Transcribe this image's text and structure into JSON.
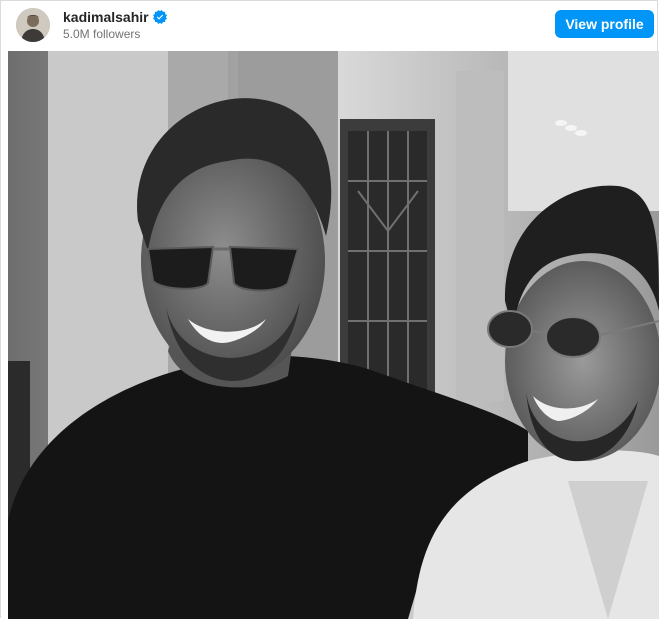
{
  "profile": {
    "username": "kadimalsahir",
    "followers": "5.0M followers",
    "view_profile_label": "View profile",
    "verified": true
  },
  "colors": {
    "primary_button": "#0095f6",
    "verified_badge": "#0095f6",
    "username_text": "#262626",
    "secondary_text": "#737373"
  },
  "icons": [
    "avatar",
    "verified-badge-icon"
  ],
  "post": {
    "image_style": "black-and-white photo"
  }
}
